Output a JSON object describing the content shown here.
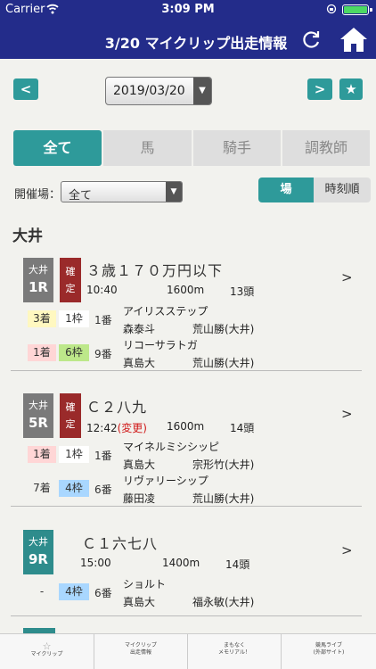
{
  "status": {
    "carrier": "Carrier",
    "time": "3:09 PM"
  },
  "header": {
    "title": "3/20 マイクリップ出走情報"
  },
  "date": {
    "value": "2019/03/20",
    "prev": "<",
    "next": ">",
    "star": "★"
  },
  "tabs": [
    {
      "label": "全て",
      "active": true
    },
    {
      "label": "馬",
      "active": false
    },
    {
      "label": "騎手",
      "active": false
    },
    {
      "label": "調教師",
      "active": false
    }
  ],
  "filter": {
    "label": "開催場：",
    "value": "全て",
    "sort_venue": "場",
    "sort_time": "時刻順"
  },
  "section": {
    "venue": "大井"
  },
  "races": [
    {
      "venue": "大井",
      "num": "1R",
      "status_top": "確",
      "status_bottom": "定",
      "name": "３歳１７０万円以下",
      "time": "10:40",
      "changed": "",
      "distance": "1600m",
      "heads": "13頭",
      "entries": [
        {
          "pos": "3着",
          "waku": "1枠",
          "ban": "1番",
          "horse": "アイリスステップ",
          "jockey": "森泰斗",
          "trainer": "荒山勝(大井)"
        },
        {
          "pos": "1着",
          "waku": "6枠",
          "ban": "9番",
          "horse": "リコーサラトガ",
          "jockey": "真島大",
          "trainer": "荒山勝(大井)"
        }
      ]
    },
    {
      "venue": "大井",
      "num": "5R",
      "status_top": "確",
      "status_bottom": "定",
      "name": "Ｃ２八九",
      "time": "12:42",
      "changed": "(変更)",
      "distance": "1600m",
      "heads": "14頭",
      "entries": [
        {
          "pos": "1着",
          "waku": "1枠",
          "ban": "1番",
          "horse": "マイネルミシシッピ",
          "jockey": "真島大",
          "trainer": "宗形竹(大井)"
        },
        {
          "pos": "7着",
          "waku": "4枠",
          "ban": "6番",
          "horse": "リヴァリーシップ",
          "jockey": "藤田凌",
          "trainer": "荒山勝(大井)"
        }
      ]
    },
    {
      "venue": "大井",
      "num": "9R",
      "name": "Ｃ１六七八",
      "time": "15:00",
      "distance": "1400m",
      "heads": "14頭",
      "entries": [
        {
          "pos": "-",
          "waku": "4枠",
          "ban": "6番",
          "horse": "ショルト",
          "jockey": "真島大",
          "trainer": "福永敏(大井)"
        }
      ]
    }
  ],
  "chev": ">",
  "tabbar": [
    {
      "line1": "マイクリップ",
      "line2": ""
    },
    {
      "line1": "マイクリップ",
      "line2": "出走情報"
    },
    {
      "line1": "まもなく",
      "line2": "メモリアル！"
    },
    {
      "line1": "競馬ライブ",
      "line2": "(外部サイト)"
    }
  ]
}
